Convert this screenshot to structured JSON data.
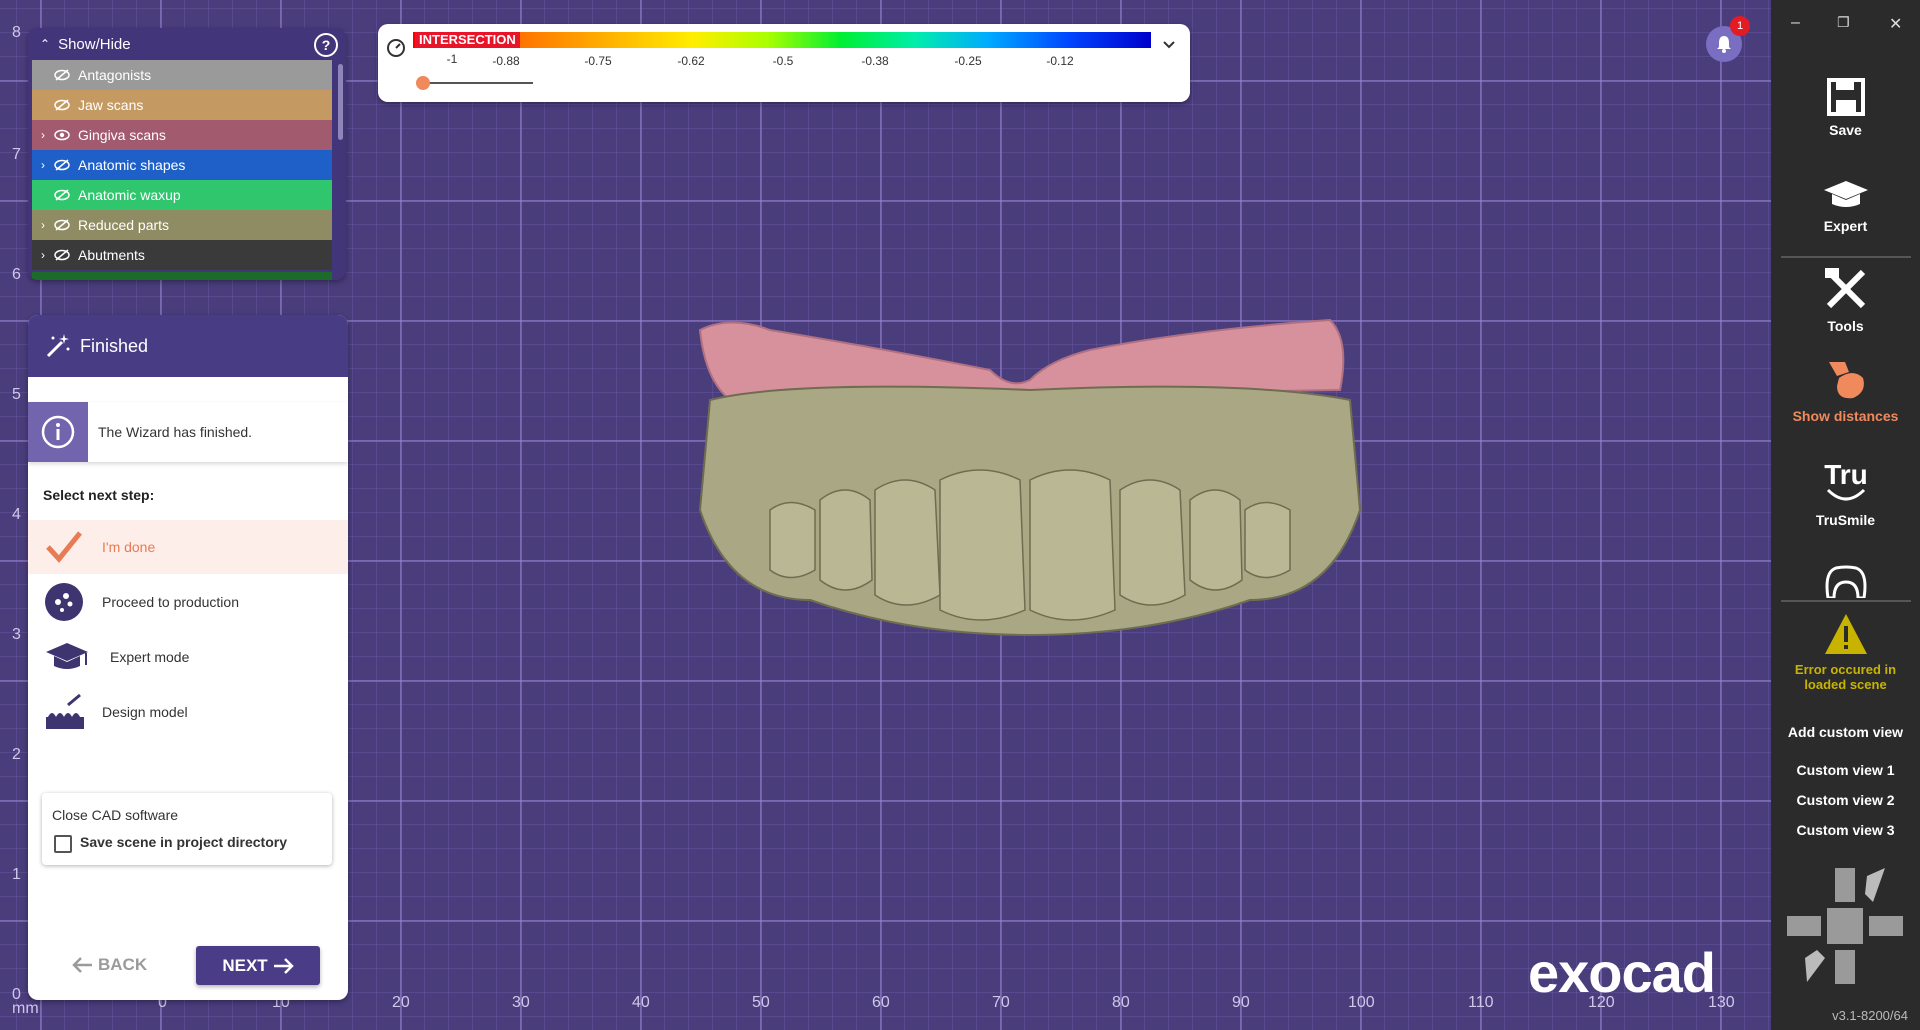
{
  "rulers": {
    "left": [
      "8",
      "7",
      "6",
      "5",
      "4",
      "3",
      "2",
      "1",
      "0"
    ],
    "bottom": [
      "mm",
      "0",
      "10",
      "20",
      "30",
      "40",
      "50",
      "60",
      "70",
      "80",
      "90",
      "100",
      "110",
      "120",
      "130"
    ]
  },
  "show_hide": {
    "title": "Show/Hide",
    "layers": [
      {
        "label": "Antagonists",
        "color": "#9a9a9a",
        "expandable": false,
        "visible": false
      },
      {
        "label": "Jaw scans",
        "color": "#c59a62",
        "expandable": false,
        "visible": false
      },
      {
        "label": "Gingiva scans",
        "color": "#a25a6e",
        "expandable": true,
        "visible": true
      },
      {
        "label": "Anatomic shapes",
        "color": "#1e5fc8",
        "expandable": true,
        "visible": false
      },
      {
        "label": "Anatomic waxup",
        "color": "#2fc66e",
        "expandable": false,
        "visible": false
      },
      {
        "label": "Reduced parts",
        "color": "#8f8c63",
        "expandable": true,
        "visible": false
      },
      {
        "label": "Abutments",
        "color": "#3a3a3a",
        "expandable": true,
        "visible": false
      }
    ]
  },
  "wizard": {
    "title": "Finished",
    "info": "The Wizard has finished.",
    "select_label": "Select next step:",
    "options": [
      {
        "label": "I'm done",
        "icon": "checkmark-icon"
      },
      {
        "label": "Proceed to production",
        "icon": "production-icon"
      },
      {
        "label": "Expert mode",
        "icon": "graduation-cap-icon"
      },
      {
        "label": "Design model",
        "icon": "design-model-icon"
      }
    ],
    "close_label": "Close CAD software",
    "save_scene_label": "Save scene in project directory",
    "back_label": "BACK",
    "next_label": "NEXT"
  },
  "colorbar": {
    "title": "INTERSECTION",
    "ticks": [
      "-1",
      "-0.88",
      "-0.75",
      "-0.62",
      "-0.5",
      "-0.38",
      "-0.25",
      "-0.12"
    ]
  },
  "notifications": {
    "count": "1"
  },
  "toolbar": {
    "save": "Save",
    "expert": "Expert",
    "tools": "Tools",
    "show_distances": "Show distances",
    "trusmile": "TruSmile",
    "error": "Error occured in loaded scene",
    "add_custom_view": "Add custom view",
    "custom_views": [
      "Custom view 1",
      "Custom view 2",
      "Custom view 3"
    ],
    "version": "v3.1-8200/64"
  },
  "logo": "exocad",
  "colors": {
    "accent": "#483c85",
    "selected_option": "#e87b55",
    "warning": "#c8b400"
  }
}
